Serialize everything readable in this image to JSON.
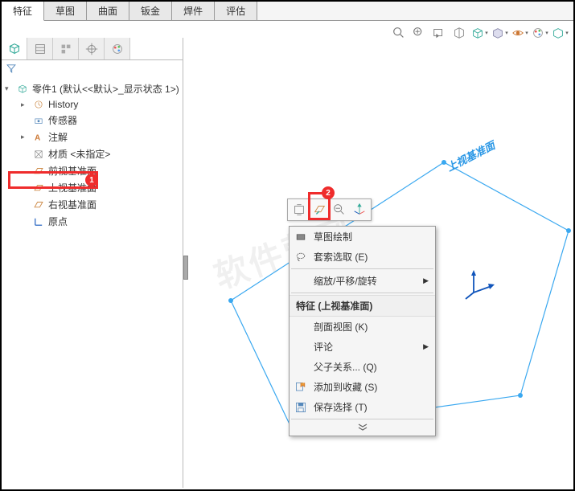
{
  "tabs": {
    "t0": "特征",
    "t1": "草图",
    "t2": "曲面",
    "t3": "钣金",
    "t4": "焊件",
    "t5": "评估"
  },
  "tree": {
    "root": "零件1 (默认<<默认>_显示状态 1>)",
    "history": "History",
    "sensor": "传感器",
    "annot": "注解",
    "material": "材质 <未指定>",
    "front": "前视基准面",
    "top": "上视基准面",
    "right": "右视基准面",
    "origin": "原点"
  },
  "annot": {
    "badge1": "1",
    "badge2": "2"
  },
  "plane_label": "上视基准面",
  "menu": {
    "sketch_draw": "草图绘制",
    "lasso": "套索选取 (E)",
    "zoom": "缩放/平移/旋转",
    "header": "特征 (上视基准面)",
    "section": "剖面视图 (K)",
    "comment": "评论",
    "parent": "父子关系... (Q)",
    "favorite": "添加到收藏 (S)",
    "save_sel": "保存选择 (T)"
  }
}
